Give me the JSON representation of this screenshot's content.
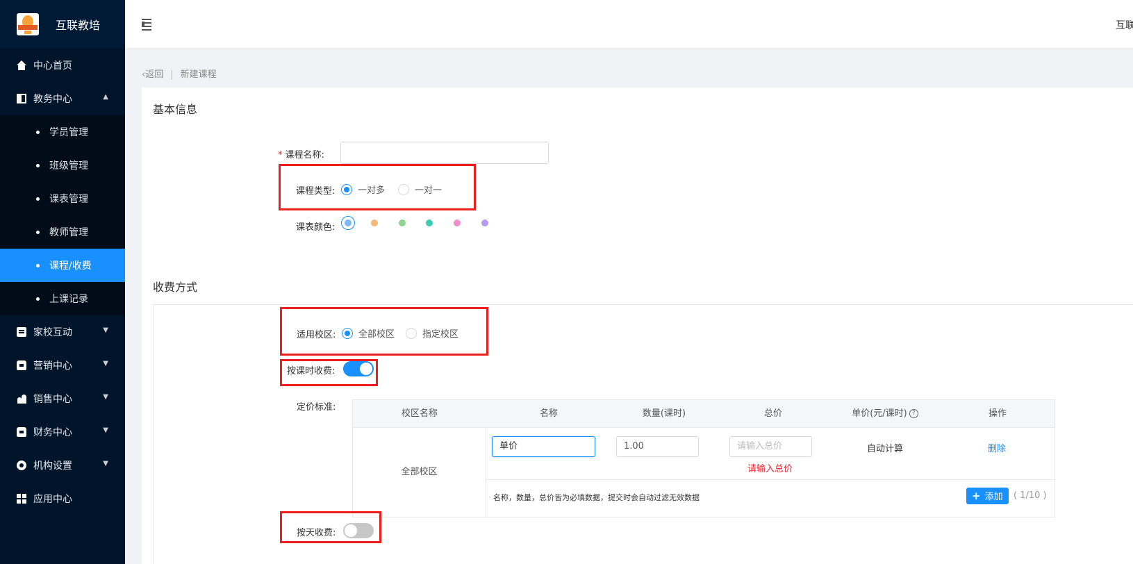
{
  "brand": {
    "name": "互联教培",
    "logo_icon": "bulb-logo-icon"
  },
  "header": {
    "menu_icon": "indent-menu-icon",
    "user_text": "互联"
  },
  "sidebar": {
    "items": [
      {
        "label": "中心首页",
        "icon": "home-icon"
      },
      {
        "label": "教务中心",
        "icon": "book-icon",
        "expanded": true
      },
      {
        "label": "家校互动",
        "icon": "chat-icon"
      },
      {
        "label": "营销中心",
        "icon": "bag-icon"
      },
      {
        "label": "销售中心",
        "icon": "people-icon"
      },
      {
        "label": "财务中心",
        "icon": "wallet-icon"
      },
      {
        "label": "机构设置",
        "icon": "gear-icon"
      },
      {
        "label": "应用中心",
        "icon": "grid-icon"
      }
    ],
    "submenu": [
      {
        "label": "学员管理"
      },
      {
        "label": "班级管理"
      },
      {
        "label": "课表管理"
      },
      {
        "label": "教师管理"
      },
      {
        "label": "课程/收费",
        "active": true
      },
      {
        "label": "上课记录"
      }
    ],
    "active_color": "#1890ff"
  },
  "breadcrumb": {
    "back": "返回",
    "separator": "|",
    "current": "新建课程"
  },
  "basic": {
    "title": "基本信息",
    "course_name_label": "课程名称:",
    "course_name_value": "",
    "course_type_label": "课程类型:",
    "course_type_options": [
      "一对多",
      "一对一"
    ],
    "course_type_selected": "一对多",
    "color_label": "课表颜色:",
    "colors": [
      "#7db9f5",
      "#f5b77a",
      "#8fd48f",
      "#3ccbb4",
      "#f08ccc",
      "#b49cf0"
    ],
    "color_selected_index": 0
  },
  "charge": {
    "title": "收费方式",
    "campus_label": "适用校区:",
    "campus_options": [
      "全部校区",
      "指定校区"
    ],
    "campus_selected": "全部校区",
    "by_lesson_label": "按课时收费:",
    "by_lesson_on": true,
    "pricing_label": "定价标准:",
    "table": {
      "headers": [
        "校区名称",
        "名称",
        "数量(课时)",
        "总价",
        "单价(元/课时)",
        "操作"
      ],
      "help_icon": "question-circle-icon",
      "campus_cell": "全部校区",
      "name_value": "单价",
      "quantity_value": "1.00",
      "total_placeholder": "请输入总价",
      "unit_price": "自动计算",
      "delete_label": "删除",
      "error": "请输入总价",
      "note": "名称，数量，总价皆为必填数据，提交时会自动过滤无效数据",
      "add_label": "添加",
      "count": "( 1/10 )"
    },
    "by_day_label": "按天收费:",
    "by_day_on": false
  },
  "highlight_color": "#ef1e1e"
}
